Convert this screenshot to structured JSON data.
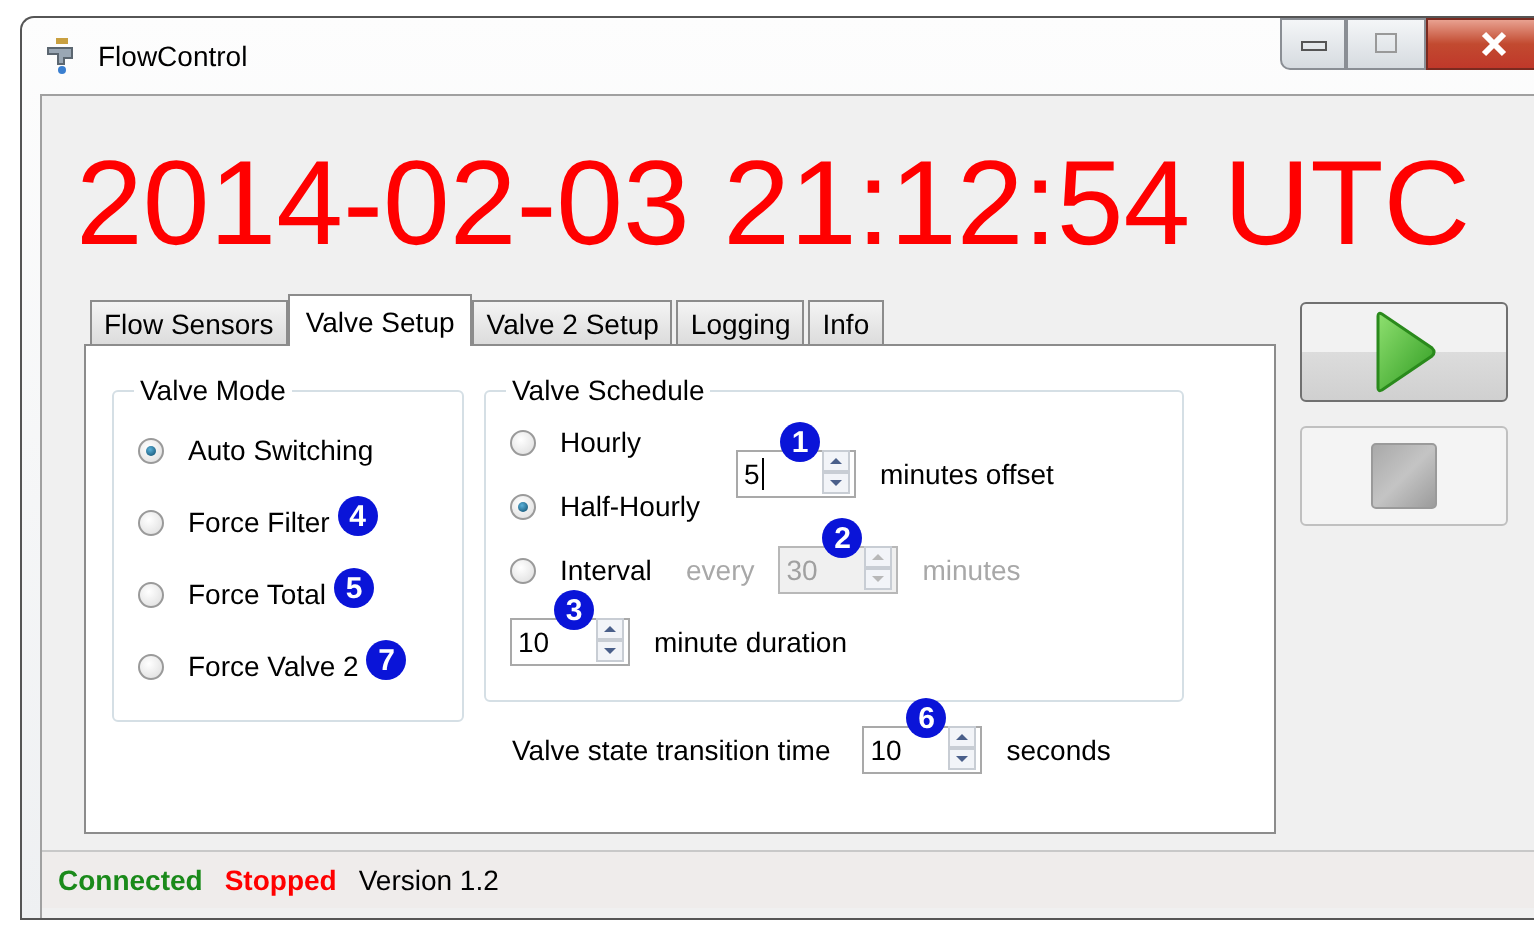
{
  "window": {
    "title": "FlowControl"
  },
  "clock": "2014-02-03 21:12:54 UTC",
  "tabs": [
    {
      "label": "Flow Sensors",
      "selected": false
    },
    {
      "label": "Valve Setup",
      "selected": true
    },
    {
      "label": "Valve 2 Setup",
      "selected": false
    },
    {
      "label": "Logging",
      "selected": false
    },
    {
      "label": "Info",
      "selected": false
    }
  ],
  "valve_mode": {
    "title": "Valve Mode",
    "options": [
      {
        "label": "Auto Switching",
        "selected": true
      },
      {
        "label": "Force Filter",
        "selected": false,
        "badge": "4"
      },
      {
        "label": "Force Total",
        "selected": false,
        "badge": "5"
      },
      {
        "label": "Force Valve 2",
        "selected": false,
        "badge": "7"
      }
    ]
  },
  "valve_schedule": {
    "title": "Valve Schedule",
    "options": [
      {
        "label": "Hourly",
        "selected": false
      },
      {
        "label": "Half-Hourly",
        "selected": true
      },
      {
        "label": "Interval",
        "selected": false
      }
    ],
    "offset": {
      "value": "5",
      "badge": "1",
      "unit": "minutes offset",
      "disabled": false
    },
    "interval": {
      "prefix": "every",
      "value": "30",
      "badge": "2",
      "unit": "minutes",
      "disabled": true
    },
    "duration": {
      "value": "10",
      "badge": "3",
      "unit": "minute duration",
      "disabled": false
    }
  },
  "transition": {
    "label": "Valve state transition time",
    "value": "10",
    "badge": "6",
    "unit": "seconds",
    "disabled": false
  },
  "buttons": [
    {
      "kind": "start",
      "disabled": false
    },
    {
      "kind": "stop",
      "disabled": true
    }
  ],
  "status_bar": [
    {
      "text": "Connected",
      "color": "#1a8a1a"
    },
    {
      "text": "Stopped",
      "color": "#ff0000"
    },
    {
      "text": "Version 1.2",
      "color": "#000000"
    }
  ]
}
